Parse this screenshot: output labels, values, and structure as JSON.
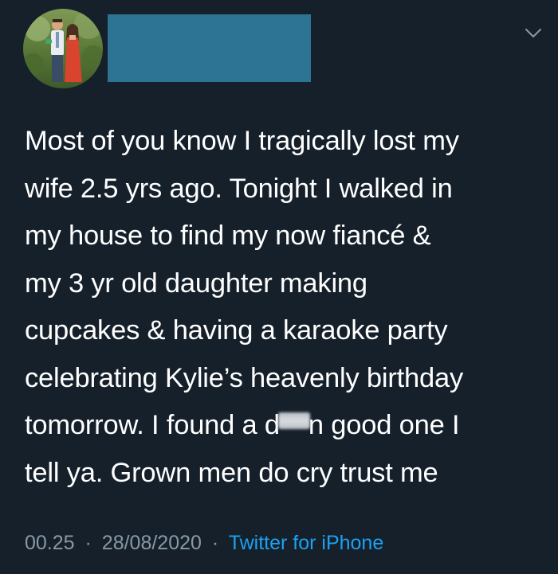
{
  "tweet": {
    "text_lines": [
      "Most of you know I tragically lost my",
      "wife 2.5 yrs ago. Tonight I walked in",
      "my house to find my now fiancé &",
      "my 3 yr old daughter making",
      "cupcakes & having a karaoke party",
      "celebrating Kylie’s heavenly birthday"
    ],
    "line7_before": "tomorrow. I found a d",
    "line7_after": "n good one I",
    "line8": "tell ya. Grown men do cry trust me",
    "time": "00.25",
    "date": "28/08/2020",
    "source": "Twitter for iPhone",
    "separator": "·"
  },
  "icons": {
    "menu": "chevron-down-icon",
    "avatar": "profile-photo"
  },
  "colors": {
    "background": "#15202b",
    "text": "#ffffff",
    "meta": "#8899a6",
    "link": "#1da1f2",
    "redaction": "#2d7394"
  }
}
